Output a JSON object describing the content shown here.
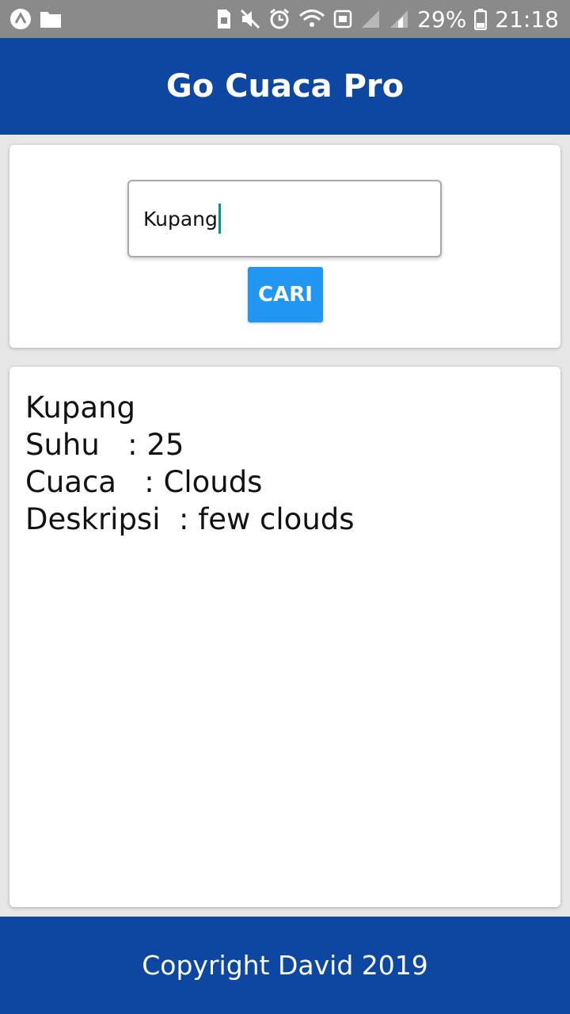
{
  "status_bar": {
    "battery_percent": "29%",
    "time": "21:18",
    "icons_left": [
      "app-a-icon",
      "folder-icon"
    ],
    "icons_right": [
      "sim-icon",
      "mute-icon",
      "alarm-icon",
      "wifi-icon",
      "data-icon",
      "signal-icon",
      "signal2-icon",
      "battery-icon"
    ]
  },
  "app_bar": {
    "title": "Go Cuaca Pro",
    "color": "#0d47a1"
  },
  "search": {
    "value": "Kupang",
    "button_label": "CARI",
    "button_color": "#2196f3"
  },
  "result": {
    "city": "Kupang",
    "lines": [
      "Kupang",
      "Suhu   : 25",
      "Cuaca   : Clouds",
      "Deskripsi  : few clouds"
    ]
  },
  "footer": {
    "text": "Copyright David 2019",
    "color": "#0d47a1"
  }
}
